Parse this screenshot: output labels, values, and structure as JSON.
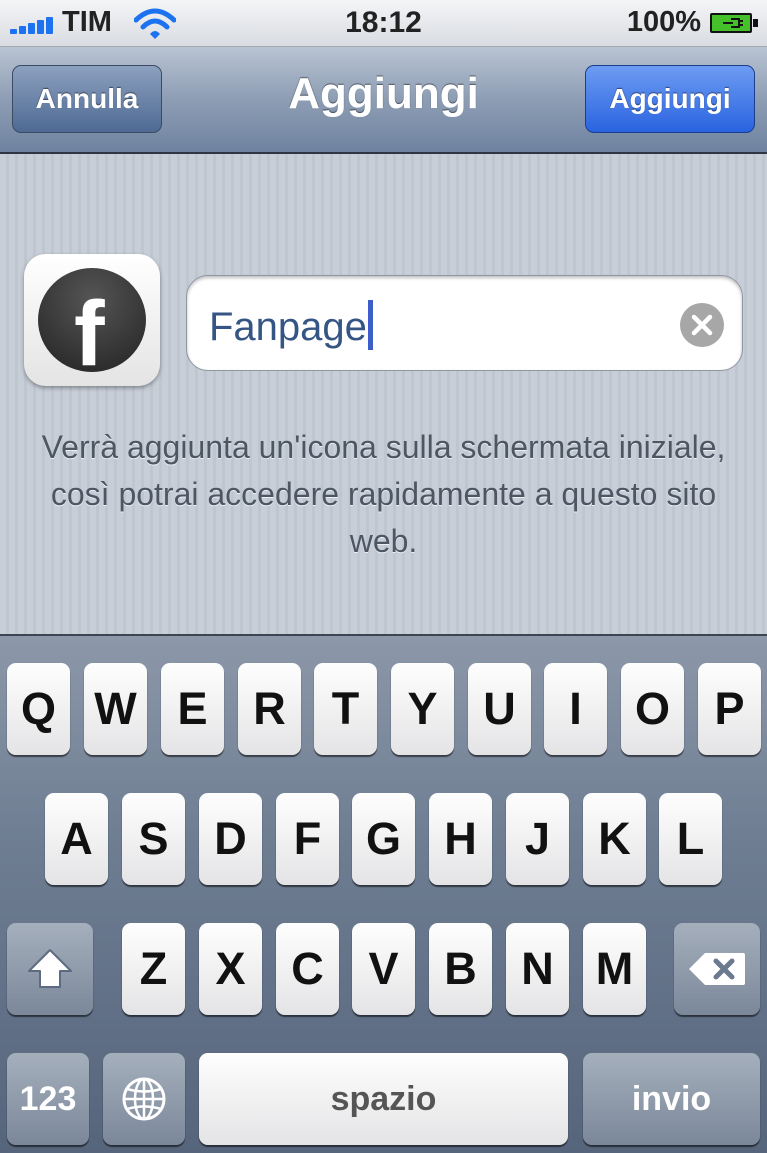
{
  "status_bar": {
    "carrier": "TIM",
    "time": "18:12",
    "battery_percent": "100%",
    "signal_bars": 5,
    "icons": [
      "signal-icon",
      "wifi-icon",
      "battery-charging-icon"
    ]
  },
  "nav_bar": {
    "title": "Aggiungi",
    "cancel_label": "Annulla",
    "add_label": "Aggiungi"
  },
  "bookmark": {
    "icon": "facebook-icon",
    "name_value": "Fanpage"
  },
  "description": "Verrà aggiunta un'icona sulla schermata iniziale, così potrai accedere rapidamente a questo sito web.",
  "keyboard": {
    "row1": [
      "Q",
      "W",
      "E",
      "R",
      "T",
      "Y",
      "U",
      "I",
      "O",
      "P"
    ],
    "row2": [
      "A",
      "S",
      "D",
      "F",
      "G",
      "H",
      "J",
      "K",
      "L"
    ],
    "row3": [
      "Z",
      "X",
      "C",
      "V",
      "B",
      "N",
      "M"
    ],
    "numbers_label": "123",
    "space_label": "spazio",
    "return_label": "invio",
    "icons": [
      "shift-icon",
      "backspace-icon",
      "globe-icon"
    ]
  },
  "colors": {
    "accent_blue": "#2a63e0",
    "nav_gray": "#6f83a0"
  }
}
